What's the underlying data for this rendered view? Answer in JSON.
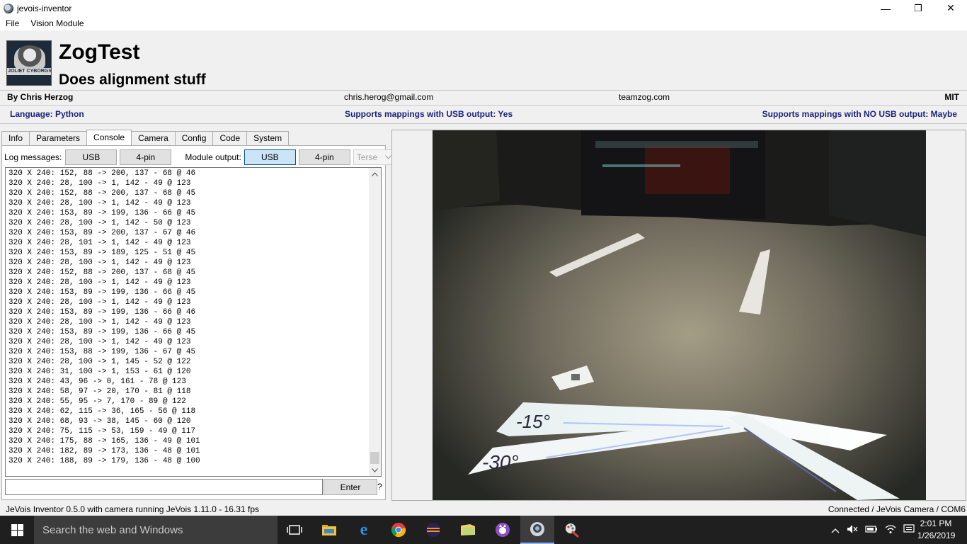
{
  "window": {
    "title": "jevois-inventor",
    "controls": {
      "minimize": "—",
      "maximize": "❐",
      "close": "✕"
    }
  },
  "menu": {
    "items": [
      "File",
      "Vision Module"
    ]
  },
  "module": {
    "logo_text": "JOLIET CYBORGS",
    "name": "ZogTest",
    "description": "Does alignment stuff",
    "author": "By Chris Herzog",
    "email": "chris.herog@gmail.com",
    "website": "teamzog.com",
    "license": "MIT",
    "language": "Language: Python",
    "usb_support": "Supports mappings with USB output: Yes",
    "nousb_support": "Supports mappings with NO USB output: Maybe"
  },
  "tabs": [
    "Info",
    "Parameters",
    "Console",
    "Camera",
    "Config",
    "Code",
    "System"
  ],
  "active_tab": "Console",
  "console": {
    "log_label": "Log messages:",
    "log_usb": "USB",
    "log_4pin": "4-pin",
    "output_label": "Module output:",
    "out_usb": "USB",
    "out_4pin": "4-pin",
    "verbosity": "Terse",
    "lines": [
      "320 X 240: 152, 88 -> 200, 137 - 68 @ 46",
      "320 X 240: 28, 100 -> 1, 142 - 49 @ 123",
      "320 X 240: 152, 88 -> 200, 137 - 68 @ 45",
      "320 X 240: 28, 100 -> 1, 142 - 49 @ 123",
      "320 X 240: 153, 89 -> 199, 136 - 66 @ 45",
      "320 X 240: 28, 100 -> 1, 142 - 50 @ 123",
      "320 X 240: 153, 89 -> 200, 137 - 67 @ 46",
      "320 X 240: 28, 101 -> 1, 142 - 49 @ 123",
      "320 X 240: 153, 89 -> 189, 125 - 51 @ 45",
      "320 X 240: 28, 100 -> 1, 142 - 49 @ 123",
      "320 X 240: 152, 88 -> 200, 137 - 68 @ 45",
      "320 X 240: 28, 100 -> 1, 142 - 49 @ 123",
      "320 X 240: 153, 89 -> 199, 136 - 66 @ 45",
      "320 X 240: 28, 100 -> 1, 142 - 49 @ 123",
      "320 X 240: 153, 89 -> 199, 136 - 66 @ 46",
      "320 X 240: 28, 100 -> 1, 142 - 49 @ 123",
      "320 X 240: 153, 89 -> 199, 136 - 66 @ 45",
      "320 X 240: 28, 100 -> 1, 142 - 49 @ 123",
      "320 X 240: 153, 88 -> 199, 136 - 67 @ 45",
      "320 X 240: 28, 100 -> 1, 145 - 52 @ 122",
      "320 X 240: 31, 100 -> 1, 153 - 61 @ 120",
      "320 X 240: 43, 96 -> 0, 161 - 78 @ 123",
      "320 X 240: 58, 97 -> 20, 170 - 81 @ 118",
      "320 X 240: 55, 95 -> 7, 170 - 89 @ 122",
      "320 X 240: 62, 115 -> 36, 165 - 56 @ 118",
      "320 X 240: 68, 93 -> 38, 145 - 60 @ 120",
      "320 X 240: 75, 115 -> 53, 159 - 49 @ 117",
      "320 X 240: 175, 88 -> 165, 136 - 49 @ 101",
      "320 X 240: 182, 89 -> 173, 136 - 48 @ 101",
      "320 X 240: 188, 89 -> 179, 136 - 48 @ 100"
    ],
    "command_value": "",
    "enter_label": "Enter",
    "help_label": "?"
  },
  "video": {
    "marker_15": "-15°",
    "marker_30": "-30°"
  },
  "status": {
    "left": "JeVois Inventor 0.5.0 with camera running JeVois 1.11.0 - 16.31 fps",
    "right": "Connected / JeVois Camera / COM6"
  },
  "taskbar": {
    "search_placeholder": "Search the web and Windows",
    "apps": [
      "task-view-icon",
      "file-explorer-icon",
      "edge-icon",
      "chrome-icon",
      "eclipse-icon",
      "folder-icon",
      "cat-app-icon",
      "jevois-inventor-icon",
      "paint-icon"
    ],
    "time": "2:01 PM",
    "date": "1/26/2019"
  }
}
